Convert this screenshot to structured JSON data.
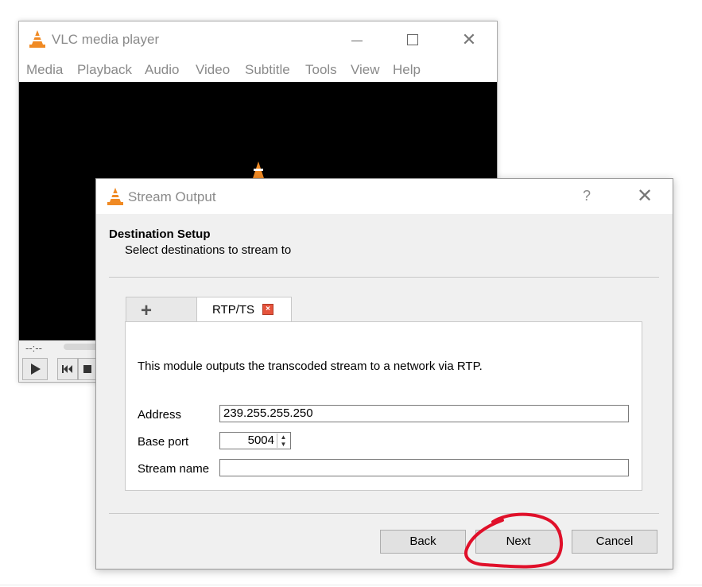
{
  "main_window": {
    "title": "VLC media player",
    "menu": [
      "Media",
      "Playback",
      "Audio",
      "Video",
      "Subtitle",
      "Tools",
      "View",
      "Help"
    ],
    "time": "--:--"
  },
  "dialog": {
    "title": "Stream Output",
    "help": "?",
    "section_title": "Destination Setup",
    "section_subtitle": "Select destinations to stream to",
    "tabs": {
      "add_symbol": "+",
      "active_label": "RTP/TS"
    },
    "module_description": "This module outputs the transcoded stream to a network via RTP.",
    "fields": {
      "address_label": "Address",
      "address_value": "239.255.255.250",
      "port_label": "Base port",
      "port_value": "5004",
      "stream_name_label": "Stream name",
      "stream_name_value": ""
    },
    "buttons": {
      "back": "Back",
      "next": "Next",
      "cancel": "Cancel"
    }
  },
  "colors": {
    "vlc_orange": "#f08a24",
    "annotation_red": "#e0102a"
  }
}
